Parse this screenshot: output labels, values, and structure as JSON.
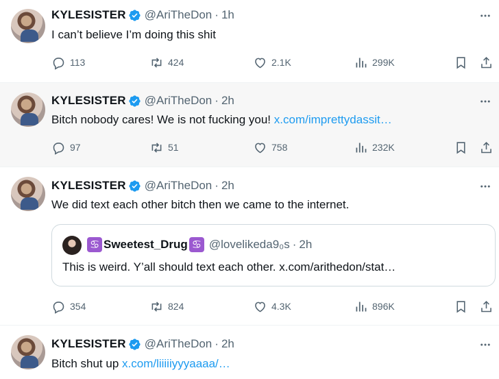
{
  "tweets": [
    {
      "name": "KYLESISTER",
      "handle": "@AriTheDon",
      "time": "1h",
      "text": "I can’t believe I’m doing this shit",
      "link": "",
      "replies": "113",
      "reposts": "424",
      "likes": "2.1K",
      "views": "299K"
    },
    {
      "name": "KYLESISTER",
      "handle": "@AriTheDon",
      "time": "2h",
      "text": "Bitch nobody cares! We is not fucking you!",
      "link": "x.com/imprettydassit…",
      "replies": "97",
      "reposts": "51",
      "likes": "758",
      "views": "232K"
    },
    {
      "name": "KYLESISTER",
      "handle": "@AriTheDon",
      "time": "2h",
      "text": "We did text each other bitch then we came to the internet.",
      "link": "",
      "replies": "354",
      "reposts": "824",
      "likes": "4.3K",
      "views": "896K"
    },
    {
      "name": "KYLESISTER",
      "handle": "@AriTheDon",
      "time": "2h",
      "text": "Bitch shut up",
      "link": "x.com/liiiiiyyyaaaa/…",
      "replies": "",
      "reposts": "",
      "likes": "",
      "views": ""
    }
  ],
  "quote": {
    "badge": "♋",
    "name": "Sweetest_Drug",
    "handle": "@lovelikeda9₀s",
    "time": "2h",
    "text": "This is weird. Y’all should text each other. x.com/arithedon/stat…"
  },
  "separator": "·",
  "icons": {
    "verified": "verified-badge-icon",
    "more": "more-icon",
    "reply": "reply-icon",
    "repost": "repost-icon",
    "like": "like-icon",
    "views": "views-icon",
    "bookmark": "bookmark-icon",
    "share": "share-icon"
  },
  "colors": {
    "accent": "#1d9bf0",
    "muted": "#536471",
    "highlight_bg": "#f7f7f7",
    "verified": "#1d9bf0"
  }
}
